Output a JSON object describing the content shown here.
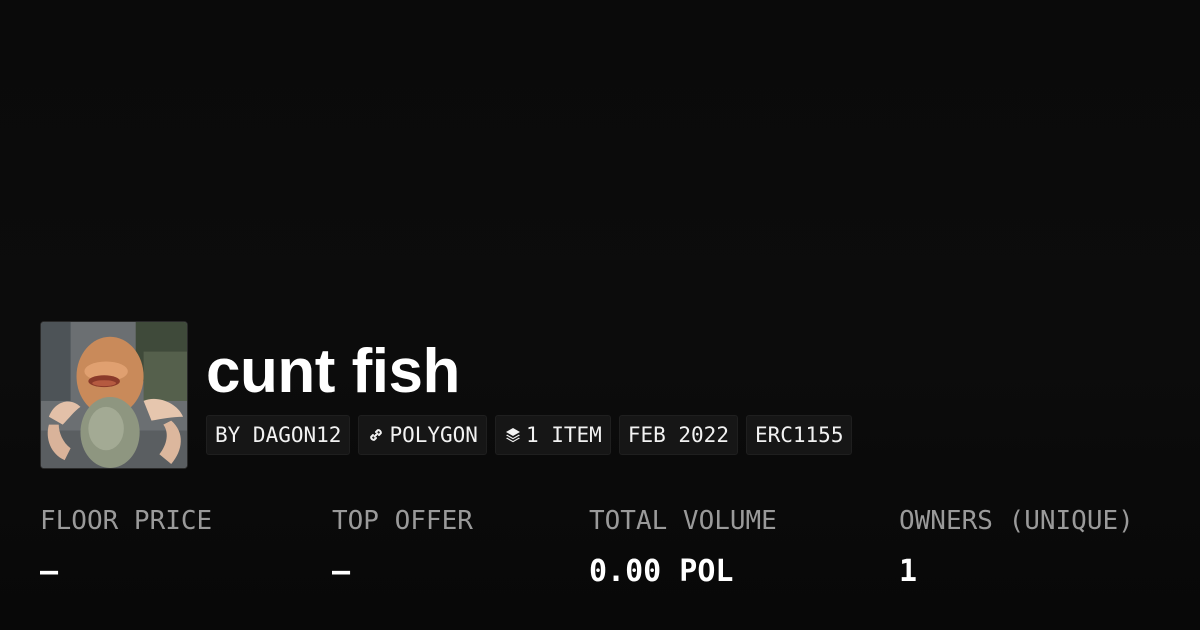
{
  "collection": {
    "title": "cunt fish",
    "thumbnail_icon": "collection-thumbnail-image"
  },
  "tags": [
    {
      "label": "BY DAGON12",
      "icon": ""
    },
    {
      "label": "POLYGON",
      "icon": "chain-link-icon"
    },
    {
      "label": "1 ITEM",
      "icon": "layers-icon"
    },
    {
      "label": "FEB 2022",
      "icon": ""
    },
    {
      "label": "ERC1155",
      "icon": ""
    }
  ],
  "stats": {
    "floor_price": {
      "label": "FLOOR PRICE",
      "value": "–"
    },
    "top_offer": {
      "label": "TOP OFFER",
      "value": "–"
    },
    "total_volume": {
      "label": "TOTAL VOLUME",
      "value": "0.00 POL"
    },
    "owners": {
      "label": "OWNERS (UNIQUE)",
      "value": "1"
    }
  },
  "colors": {
    "background": "#0b0b0b",
    "text_primary": "#ffffff",
    "text_muted": "#9a9a9a",
    "tag_background": "#161616"
  }
}
